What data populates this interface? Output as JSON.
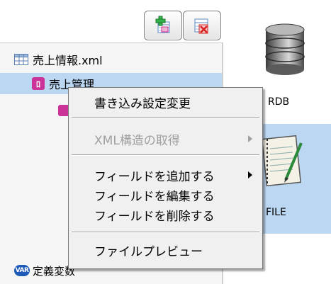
{
  "toolbar": {
    "add_icon": "add-table-icon",
    "delete_icon": "delete-table-icon"
  },
  "tree": {
    "root": {
      "icon": "table-icon",
      "label": "売上情報.xml"
    },
    "child": {
      "icon": "table-element-icon",
      "icon_text": "ﾛ",
      "label": "売上管理"
    },
    "grandchild": {
      "icon": "table-element-icon"
    },
    "variables": {
      "icon": "variable-icon",
      "icon_text": "VAR",
      "label": "定義変数"
    }
  },
  "right_panel": {
    "rdb_label": "RDB",
    "file_label": "FILE"
  },
  "context_menu": {
    "items": [
      {
        "label": "書き込み設定変更",
        "enabled": true,
        "submenu": false
      },
      {
        "label": "XML構造の取得",
        "enabled": false,
        "submenu": true
      },
      {
        "label": "フィールドを追加する",
        "enabled": true,
        "submenu": true
      },
      {
        "label": "フィールドを編集する",
        "enabled": true,
        "submenu": false
      },
      {
        "label": "フィールドを削除する",
        "enabled": true,
        "submenu": false
      },
      {
        "label": "ファイルプレビュー",
        "enabled": true,
        "submenu": false
      }
    ]
  },
  "colors": {
    "selection": "#bcd7f2",
    "element_icon": "#cc3399",
    "variable_icon": "#1e5bb8",
    "menu_bg": "#f0f0f0",
    "disabled_text": "#a0a0a0"
  }
}
